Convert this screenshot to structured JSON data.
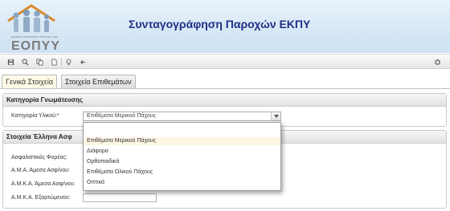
{
  "app": {
    "title": "Συνταγογράφηση Παροχών ΕΚΠΥ",
    "logo_text": "ΕΟΠΥΥ",
    "logo_tagline": "ΕΘΝΙΚΟΣ ΟΡΓΑΝΙΣΜΟΣ ΠΑΡΟΧΗΣ ΥΠΗΡΕΣΙΩΝ ΥΓΕΙΑΣ"
  },
  "toolbar": {
    "buttons": [
      "save-icon",
      "search-icon",
      "copy-icon",
      "document-icon",
      "lightbulb-icon",
      "back-arrow-icon"
    ],
    "right_button": "settings-icon"
  },
  "tabs": [
    {
      "label": "Γενικά Στοιχεία",
      "active": true
    },
    {
      "label": "Στοιχεία Επιθεμάτων",
      "active": false
    }
  ],
  "category_section": {
    "title": "Κατηγορία Γνωμάτευσης",
    "field_label": "Κατηγορία Υλικού:*",
    "selected_value": "Επιθέματα Μερικού Πάχους"
  },
  "dropdown": {
    "options": [
      "Επιθέματα Μερικού Πάχους",
      "Διάφορα",
      "Ορθοπαιδικά",
      "Επιθέματα Ολικού Πάχους",
      "Οπτικά"
    ],
    "highlighted_index": 0
  },
  "insured_section": {
    "title": "Στοιχεία Έλληνα Ασφ",
    "fields": [
      {
        "label": "Ασφαλιστικός Φορέας:"
      },
      {
        "label": "Α.Μ.Α. Άμεσα Ασφ/νου:"
      },
      {
        "label": "Α.Μ.Κ.Α. Άμεσα Ασφ/νου:"
      },
      {
        "label": "Α.Μ.Κ.Α. Εξαρτώμενου:"
      }
    ]
  },
  "colors": {
    "title": "#1f2f86",
    "header_bg": "#d6e7f5",
    "active_tab": "#fffbe8",
    "highlight": "#fdf6e3"
  }
}
